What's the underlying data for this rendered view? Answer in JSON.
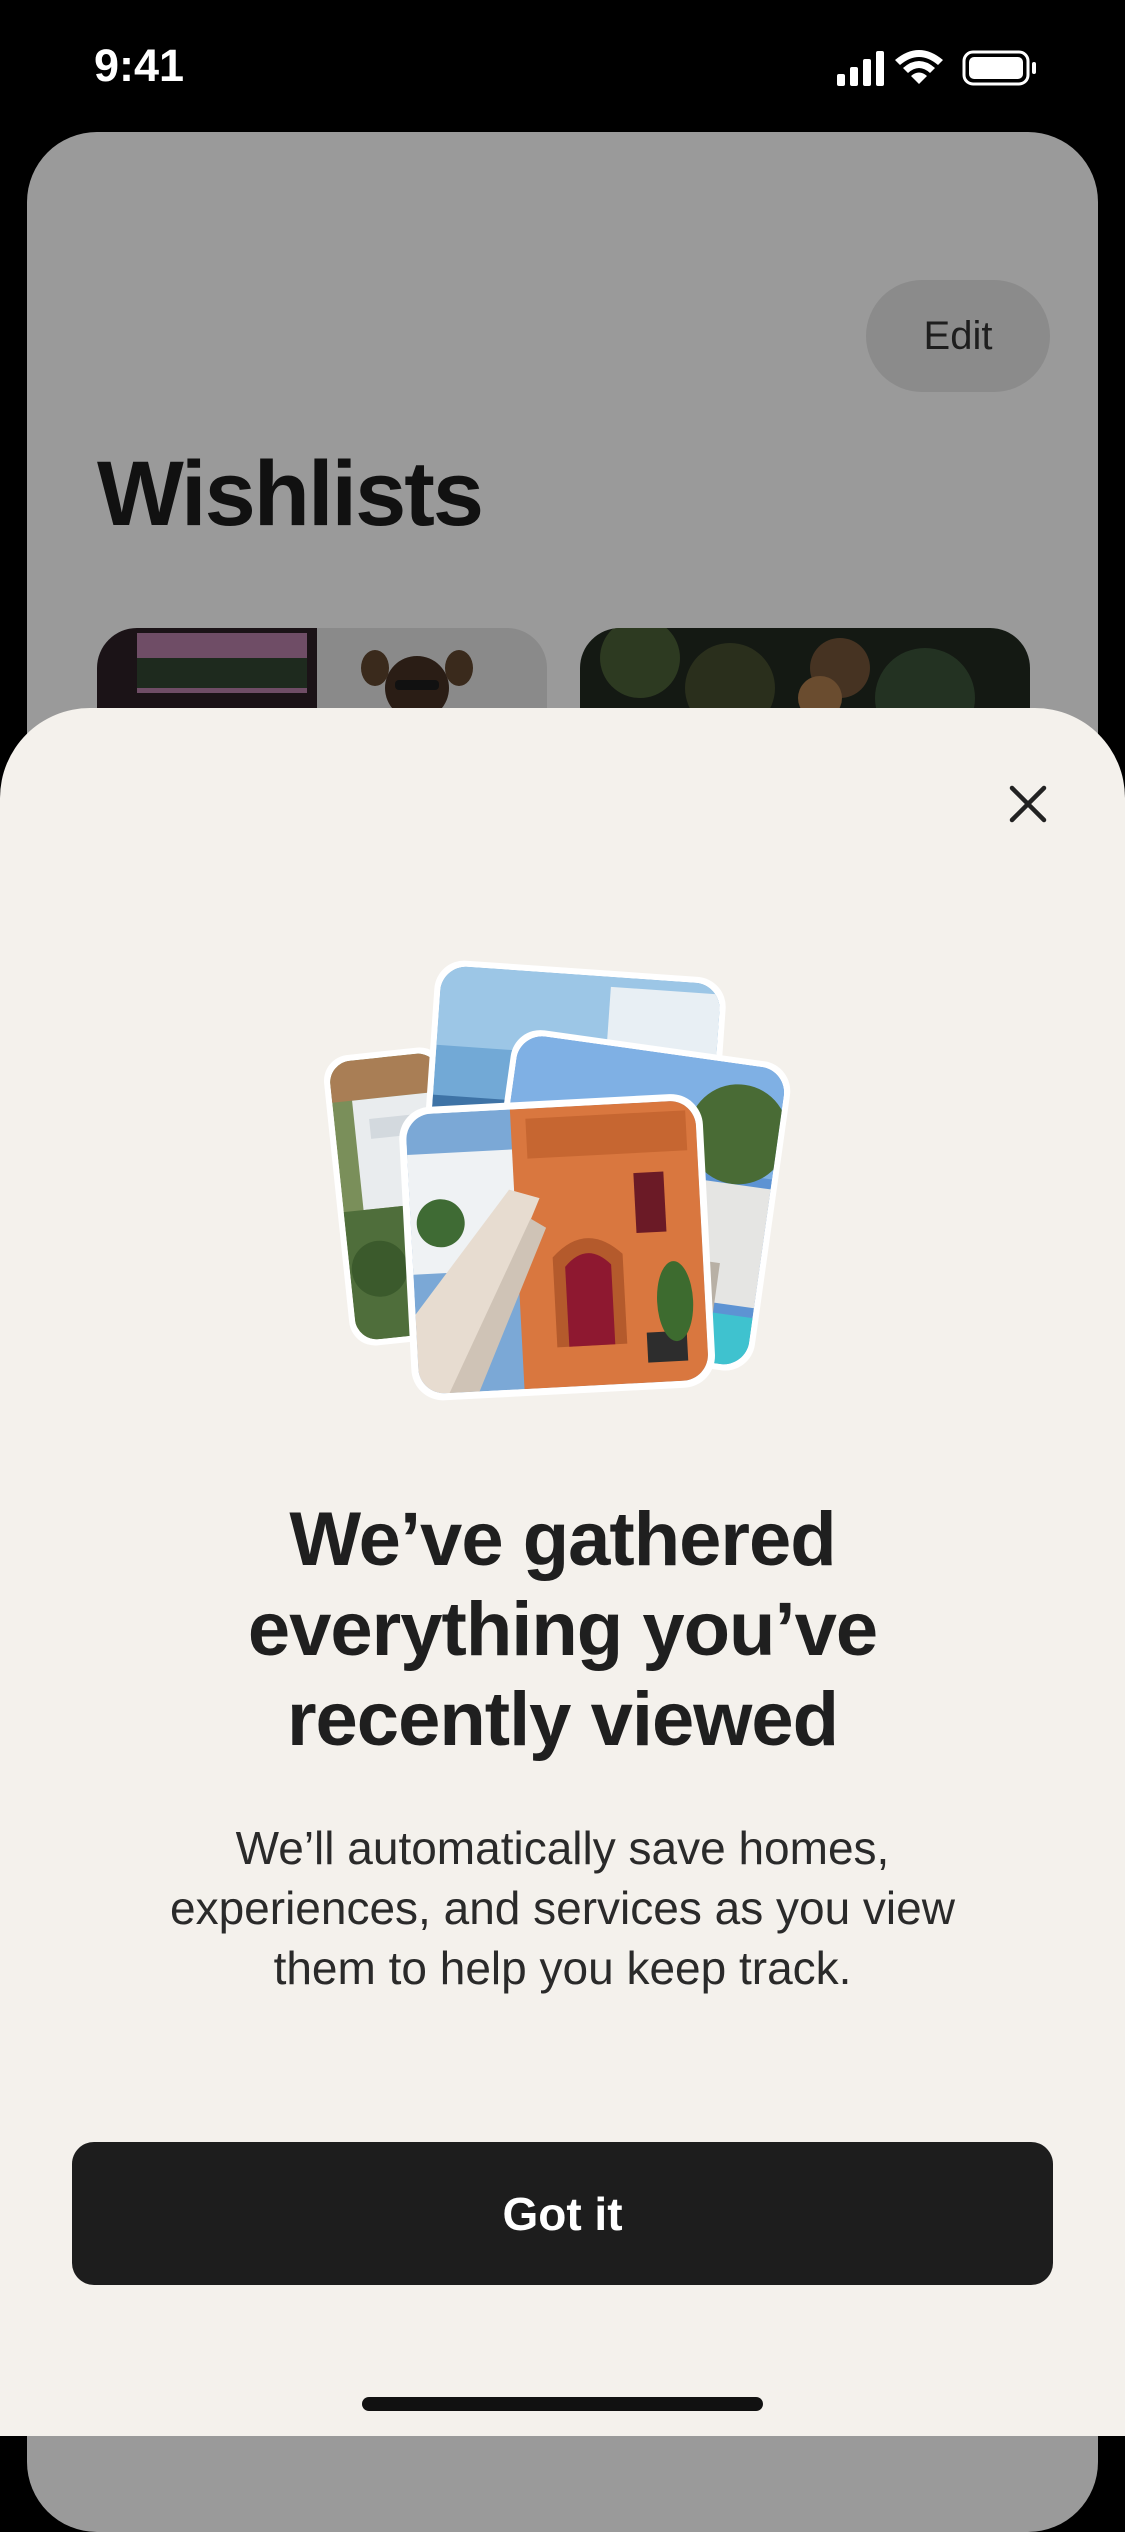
{
  "status_bar": {
    "time": "9:41",
    "icons": [
      "signal-icon",
      "wifi-icon",
      "battery-icon"
    ]
  },
  "background_page": {
    "title": "Wishlists",
    "edit_label": "Edit"
  },
  "sheet": {
    "close_icon": "close-icon",
    "heading": "We’ve gathered\neverything you’ve\nrecently viewed",
    "body": "We’ll automatically save homes,\nexperiences, and services as you view\nthem to help you keep track.",
    "primary_button": "Got it"
  },
  "colors": {
    "sheet_background": "#f4f1ec",
    "button_background": "#1d1d1d",
    "overlay_gray": "#9a9a9a",
    "door_red": "#8e1830",
    "wall_terracotta": "#d9773f"
  }
}
